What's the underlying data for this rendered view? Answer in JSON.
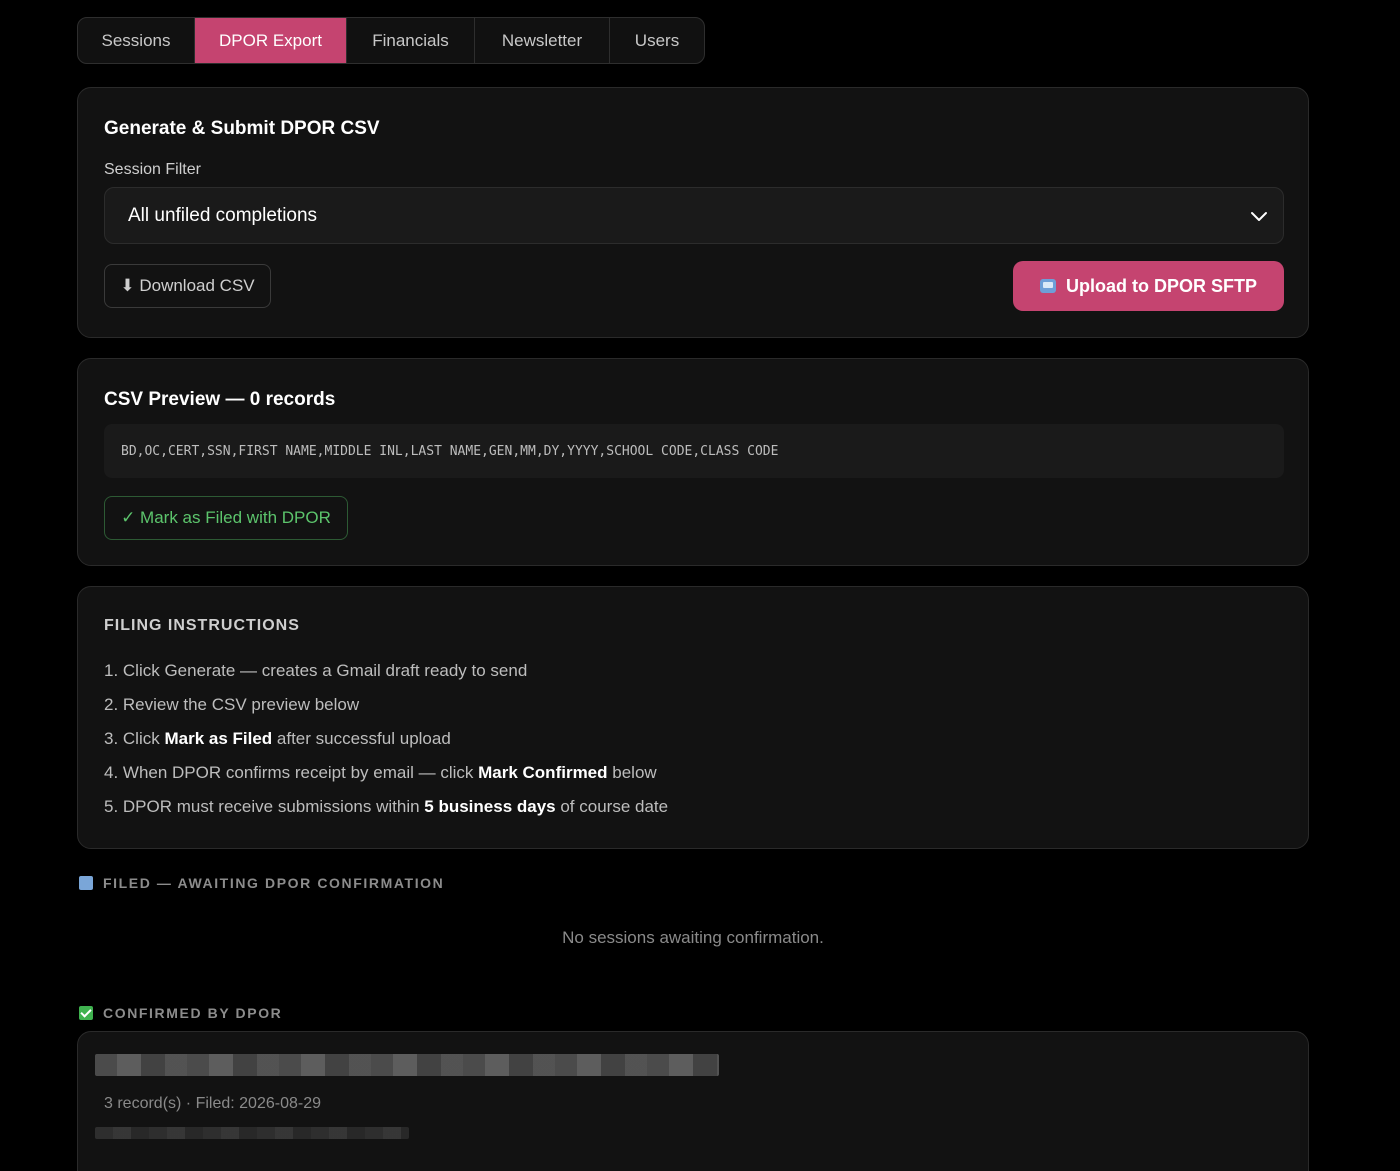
{
  "tabs": [
    {
      "label": "Sessions"
    },
    {
      "label": "DPOR Export"
    },
    {
      "label": "Financials"
    },
    {
      "label": "Newsletter"
    },
    {
      "label": "Users"
    }
  ],
  "generate": {
    "title": "Generate & Submit DPOR CSV",
    "session_filter_label": "Session Filter",
    "session_filter_value": "All unfiled completions",
    "download_label": "⬇ Download CSV",
    "upload_label": "Upload to DPOR SFTP"
  },
  "preview": {
    "title": "CSV Preview — 0 records",
    "header_line": "BD,OC,CERT,SSN,FIRST NAME,MIDDLE INL,LAST NAME,GEN,MM,DY,YYYY,SCHOOL CODE,CLASS CODE",
    "mark_filed_label": "✓ Mark as Filed with DPOR"
  },
  "instructions": {
    "heading": "FILING INSTRUCTIONS",
    "steps": [
      {
        "pre": "1. Click Generate — creates a Gmail draft ready to send",
        "bold": "",
        "post": ""
      },
      {
        "pre": "2. Review the CSV preview below",
        "bold": "",
        "post": ""
      },
      {
        "pre": "3. Click ",
        "bold": "Mark as Filed",
        "post": " after successful upload"
      },
      {
        "pre": "4. When DPOR confirms receipt by email — click ",
        "bold": "Mark Confirmed",
        "post": " below"
      },
      {
        "pre": "5. DPOR must receive submissions within ",
        "bold": "5 business days",
        "post": " of course date"
      }
    ]
  },
  "awaiting": {
    "label": "FILED — AWAITING DPOR CONFIRMATION",
    "empty_text": "No sessions awaiting confirmation."
  },
  "confirmed": {
    "label": "CONFIRMED BY DPOR",
    "items": [
      {
        "meta": "3 record(s) · Filed: 2026-08-29"
      }
    ]
  },
  "colors": {
    "accent": "#c54470",
    "success": "#5cc46c",
    "background": "#000000",
    "card": "#121212"
  },
  "icons": {
    "upload": "mailbox-icon",
    "awaiting": "mailbox-icon",
    "confirmed": "check-box-icon",
    "select": "chevron-down-icon"
  }
}
